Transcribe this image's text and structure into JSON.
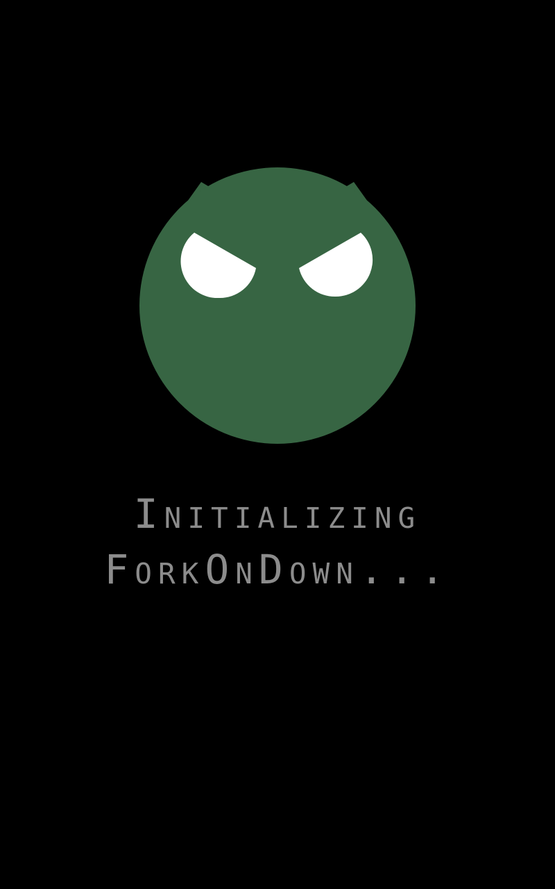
{
  "splash": {
    "icon": "angry-face-mascot-icon",
    "line1": "Initializing",
    "line2": "ForkOnDown..."
  },
  "colors": {
    "background": "#000000",
    "mascot": "#376543",
    "eyes": "#ffffff",
    "text": "#8c8c8c"
  }
}
